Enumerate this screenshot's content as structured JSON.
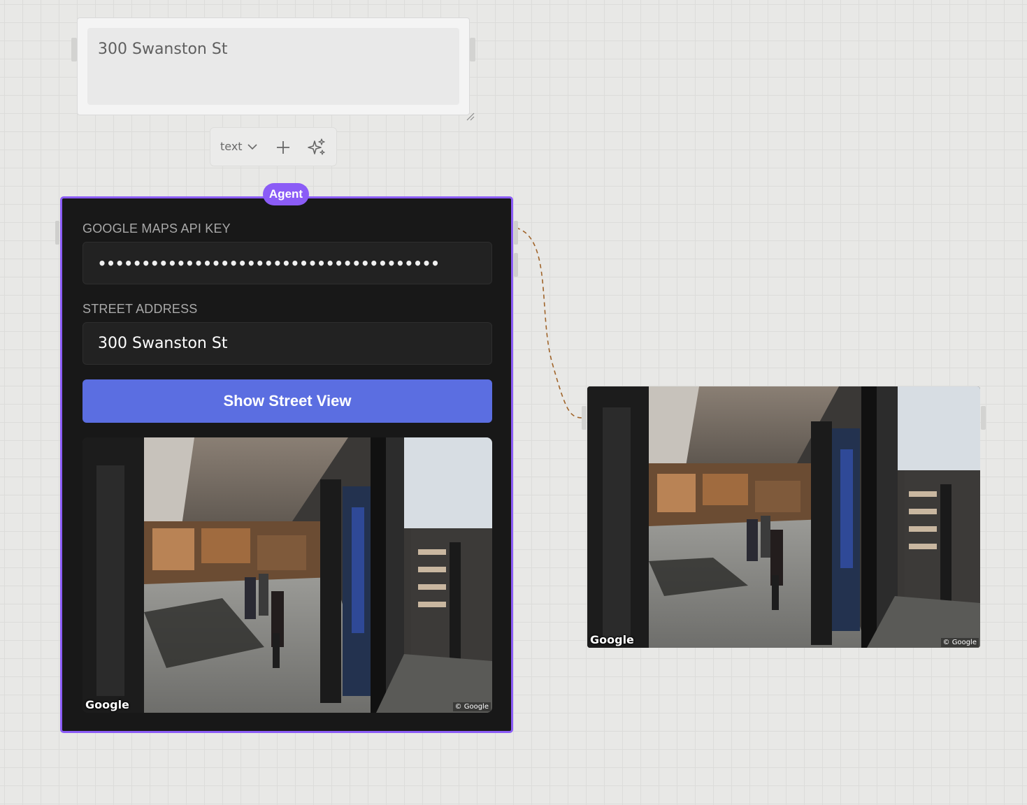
{
  "text_node": {
    "value": "300 Swanston St"
  },
  "toolbar": {
    "type_label": "text",
    "add_icon": "plus-icon",
    "ai_icon": "sparkles-icon"
  },
  "agent": {
    "badge": "Agent",
    "api_key_label": "GOOGLE MAPS API KEY",
    "api_key_value": "•••••••••••••••••••••••••••••••••••••••",
    "address_label": "STREET ADDRESS",
    "address_value": "300 Swanston St",
    "button_label": "Show Street View",
    "image": {
      "logo": "Google",
      "copyright": "© Google"
    }
  },
  "output": {
    "image": {
      "logo": "Google",
      "copyright": "© Google"
    }
  },
  "colors": {
    "accent": "#8b5cf6",
    "button": "#5b6ee1",
    "node_bg": "#181818",
    "canvas_bg": "#e8e8e6",
    "wire": "#a0642a"
  }
}
